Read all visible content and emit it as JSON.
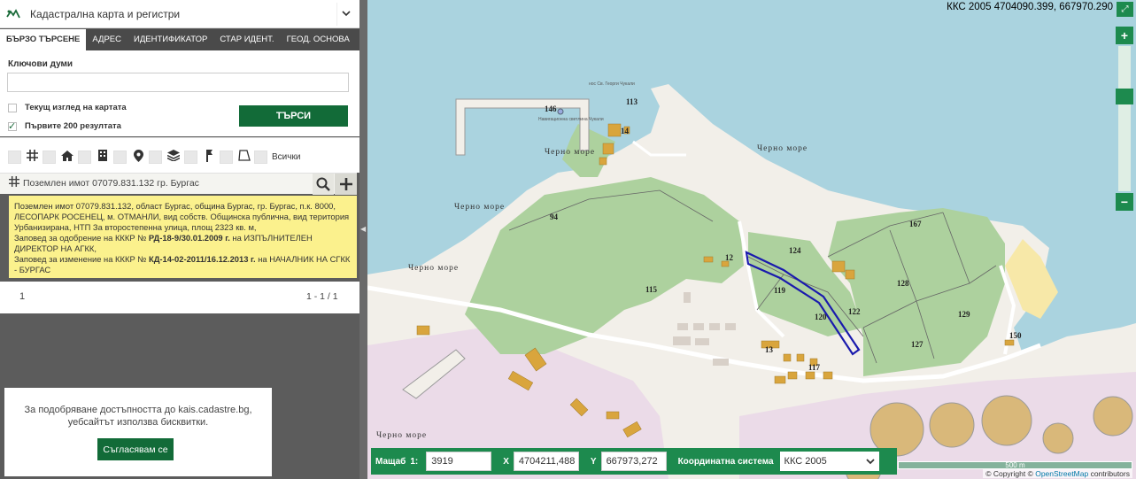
{
  "app": {
    "title": "Кадастрална карта и регистри"
  },
  "tabs": [
    {
      "label": "БЪРЗО ТЪРСЕНЕ",
      "active": true
    },
    {
      "label": "АДРЕС"
    },
    {
      "label": "ИДЕНТИФИКАТОР"
    },
    {
      "label": "СТАР ИДЕНТ."
    },
    {
      "label": "ГЕОД. ОСНОВА"
    }
  ],
  "search": {
    "keywords_label": "Ключови думи",
    "keywords_value": "",
    "current_view_label": "Текущ изглед на картата",
    "first200_label": "Първите 200 резултата",
    "current_view_checked": false,
    "first200_checked": true,
    "button_label": "ТЪРСИ"
  },
  "filters": {
    "all_label": "Всички",
    "icons": [
      "parcel-grid-icon",
      "home-icon",
      "building-icon",
      "location-pin-icon",
      "layers-icon",
      "geodetic-point-icon",
      "area-shape-icon"
    ]
  },
  "result": {
    "title": "Поземлен имот 07079.831.132 гр. Бургас",
    "desc_line1": "Поземлен имот 07079.831.132, област Бургас, община Бургас, гр. Бургас, п.к. 8000, ЛЕСОПАРК РОСЕНЕЦ, м. ОТМАНЛИ, вид собств. Общинска публична, вид територия Урбанизирана, НТП За второстепенна улица, площ 2323 кв. м,",
    "order1_prefix": "Заповед за одобрение на КККР №",
    "order1_num": "РД-18-9/30.01.2009 г.",
    "order1_suffix": "на ИЗПЪЛНИТЕЛЕН ДИРЕКТОР НА АГКК,",
    "order2_prefix": "Заповед за изменение на КККР №",
    "order2_num": "КД-14-02-2011/16.12.2013 г.",
    "order2_suffix": "на НАЧАЛНИК НА СГКК - БУРГАС"
  },
  "pager": {
    "page": "1",
    "count": "1 - 1 / 1"
  },
  "cookie": {
    "text": "За подобряване достъпността до kais.cadastre.bg, уебсайтът използва бисквитки.",
    "accept": "Съгласявам се"
  },
  "map": {
    "coords_top": "ККС 2005 4704090.399, 667970.290",
    "labels": {
      "sea": "Черно море",
      "lighthouse": "Навигационна светлина Чукали",
      "breakwater": "нос Св. Георги Чукали"
    },
    "parcels": [
      "146",
      "113",
      "14",
      "94",
      "115",
      "124",
      "119",
      "120",
      "122",
      "128",
      "167",
      "129",
      "127",
      "150",
      "12",
      "13",
      "117"
    ],
    "bottom": {
      "scale_label": "Мащаб",
      "scale_prefix": "1:",
      "scale_value": "3919",
      "x_label": "X",
      "x_value": "4704211,488",
      "y_label": "Y",
      "y_value": "667973,272",
      "cs_label": "Координатна система",
      "cs_value": "ККС 2005"
    },
    "scale_line": "500 m",
    "attribution_prefix": "© Copyright © ",
    "attribution_osm": "OpenStreetMap",
    "attribution_suffix": " contributors"
  },
  "colors": {
    "accent": "#126b38",
    "sea": "#aad3df",
    "wood": "#add19e",
    "land": "#f2efe9",
    "industrial": "#ebdbe8",
    "building": "#d9a53d",
    "highlight": "#1a1aad",
    "result_bg": "#fbf18d"
  }
}
